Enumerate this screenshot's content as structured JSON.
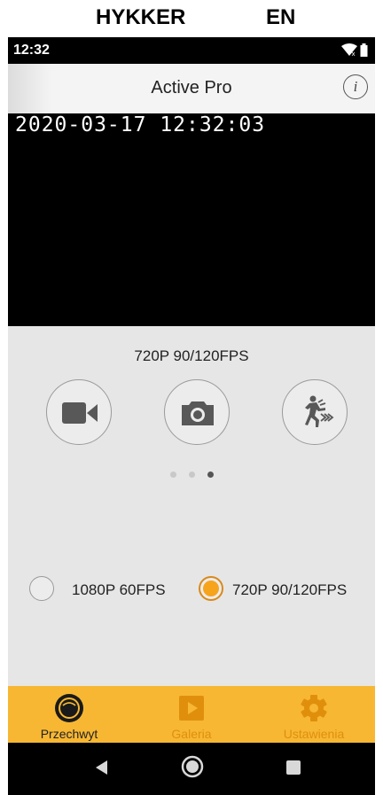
{
  "caption": {
    "brand": "HYKKER",
    "language": "EN"
  },
  "status_bar": {
    "time": "12:32",
    "icons": [
      "wifi-icon",
      "battery-icon"
    ]
  },
  "app_bar": {
    "title": "Active Pro",
    "info_icon": "info-icon",
    "info_glyph": "i"
  },
  "preview": {
    "timestamp": "2020-03-17 12:32:03"
  },
  "capture_panel": {
    "mode_label": "720P 90/120FPS",
    "modes": [
      {
        "name": "video",
        "icon": "video-camera-icon"
      },
      {
        "name": "photo",
        "icon": "photo-camera-icon"
      },
      {
        "name": "slow-motion",
        "icon": "slow-motion-icon"
      }
    ],
    "pager": {
      "pages": 3,
      "active_page": 3
    },
    "resolutions": [
      {
        "label": "1080P 60FPS",
        "selected": false
      },
      {
        "label": "720P 90/120FPS",
        "selected": true
      }
    ],
    "accent_color": "#f7a41d"
  },
  "tab_bar": {
    "background_color": "#f7b733",
    "tabs": [
      {
        "label": "Przechwyt",
        "icon": "capture-icon",
        "active": true
      },
      {
        "label": "Galeria",
        "icon": "play-icon",
        "active": false
      },
      {
        "label": "Ustawienia",
        "icon": "gear-icon",
        "active": false
      }
    ]
  },
  "system_nav": {
    "buttons": [
      "back-icon",
      "home-icon",
      "recents-icon"
    ]
  }
}
